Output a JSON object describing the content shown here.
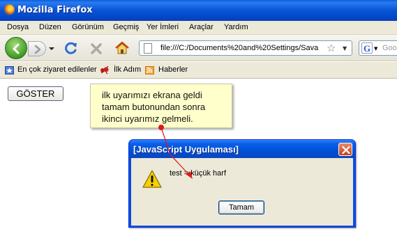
{
  "window": {
    "title": "Mozilla Firefox"
  },
  "menu": [
    "Dosya",
    "Düzen",
    "Görünüm",
    "Geçmiş",
    "Yer İmleri",
    "Araçlar",
    "Yardım"
  ],
  "navigation": {
    "url": "file:///C:/Documents%20and%20Settings/Sava",
    "search_placeholder": "Goo"
  },
  "bookmarks": [
    {
      "label": "En çok ziyaret edilenler",
      "icon": "bookmark-star-icon"
    },
    {
      "label": "İlk Adım",
      "icon": "firefox-ant-icon"
    },
    {
      "label": "Haberler",
      "icon": "rss-feed-icon"
    }
  ],
  "page": {
    "button_label": "GÖSTER",
    "annotation": [
      "ilk uyarımızı ekrana geldi",
      "tamam butonundan sonra",
      "ikinci uyarımız gelmeli."
    ]
  },
  "dialog": {
    "title": "[JavaScript Uygulaması]",
    "message": "test = küçük harf",
    "ok_label": "Tamam",
    "icon": "warning-icon"
  },
  "colors": {
    "titlebar": "#0753d6",
    "callout_bg": "#ffffcc",
    "pointer": "#e01818"
  }
}
